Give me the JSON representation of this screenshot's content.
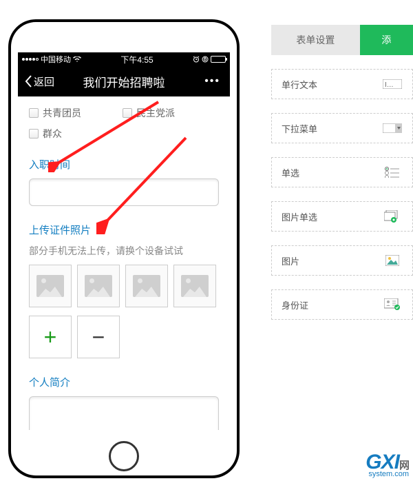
{
  "phone": {
    "status": {
      "carrier": "中国移动",
      "time": "下午4:55"
    },
    "nav": {
      "back": "返回",
      "title": "我们开始招聘啦",
      "more": "•••"
    },
    "checkboxes": [
      "共青团员",
      "民主党派",
      "群众"
    ],
    "fields": {
      "join_date": {
        "label": "入职时间"
      },
      "upload": {
        "label": "上传证件照片",
        "hint": "部分手机无法上传，请换个设备试试"
      },
      "profile": {
        "label": "个人简介"
      }
    }
  },
  "tabs": {
    "settings": "表单设置",
    "add": "添"
  },
  "components": [
    {
      "label": "单行文本",
      "icon": "text-input-icon"
    },
    {
      "label": "下拉菜单",
      "icon": "dropdown-icon"
    },
    {
      "label": "单选",
      "icon": "radio-icon"
    },
    {
      "label": "图片单选",
      "icon": "image-radio-icon"
    },
    {
      "label": "图片",
      "icon": "image-icon"
    },
    {
      "label": "身份证",
      "icon": "id-card-icon"
    }
  ],
  "watermark": {
    "brand": "GXI",
    "han": "网",
    "url": "system.com"
  }
}
